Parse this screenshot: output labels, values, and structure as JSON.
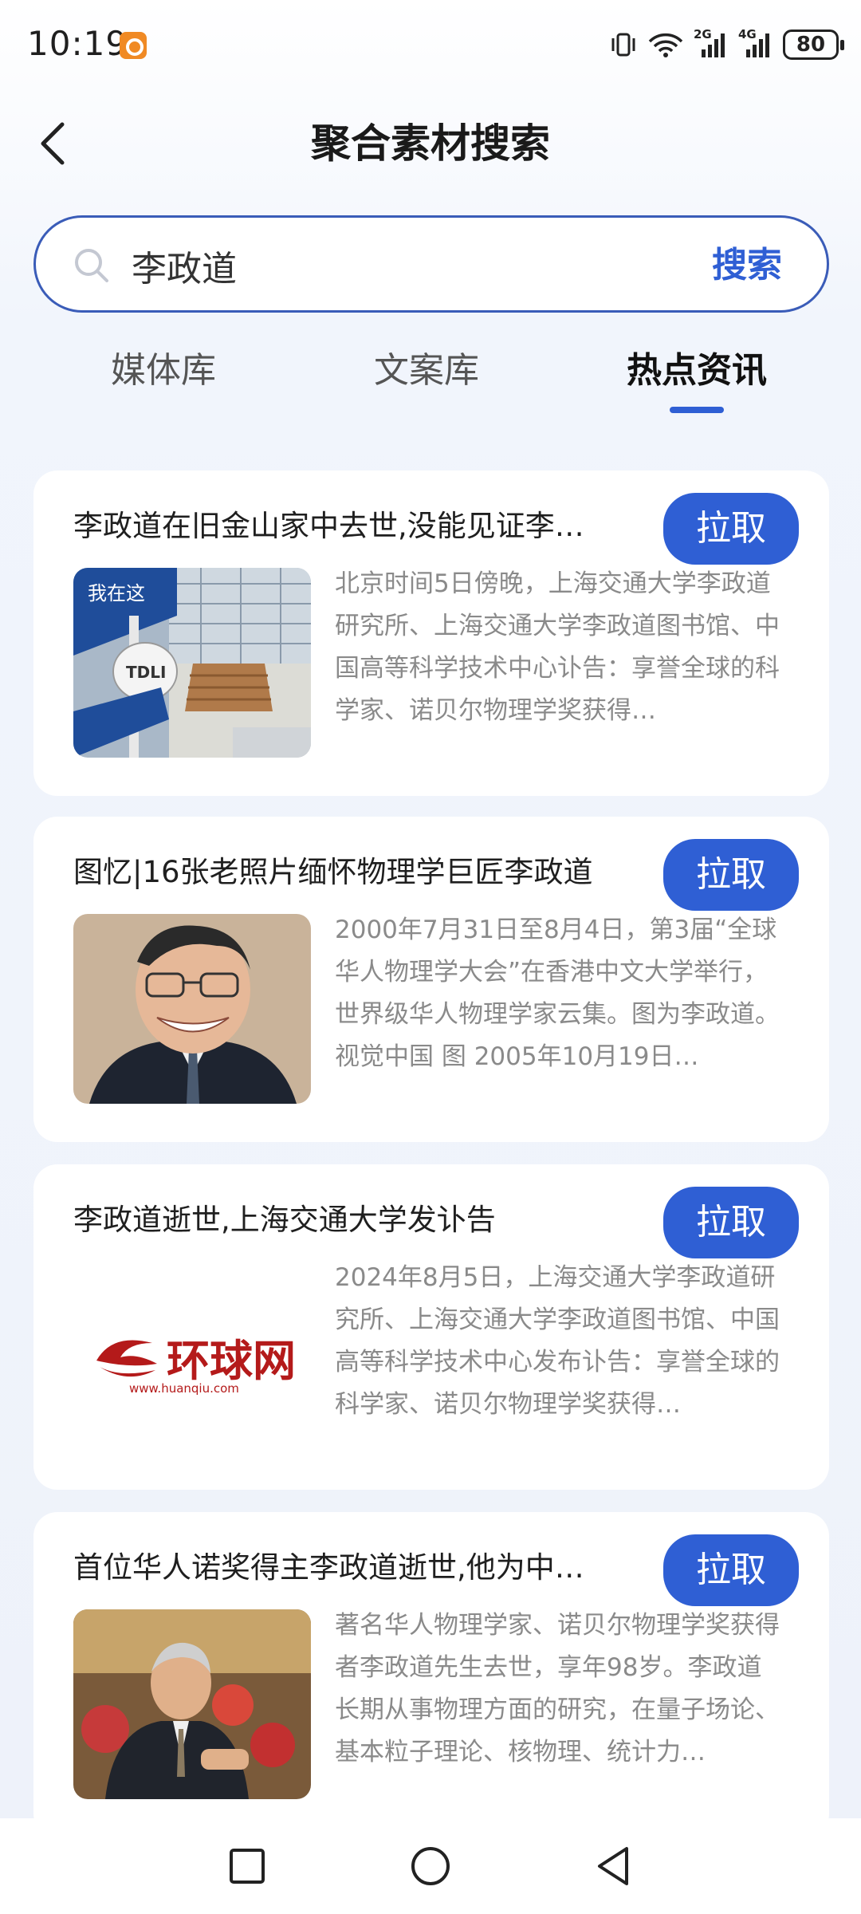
{
  "status_bar": {
    "time": "10:19",
    "battery": "80",
    "signal_1": "2G",
    "signal_2": "4G"
  },
  "header": {
    "title": "聚合素材搜索"
  },
  "search": {
    "value": "李政道",
    "button_label": "搜索"
  },
  "tabs": [
    {
      "label": "媒体库",
      "active": false
    },
    {
      "label": "文案库",
      "active": false
    },
    {
      "label": "热点资讯",
      "active": true
    }
  ],
  "pull_label": "拉取",
  "news": [
    {
      "title": "李政道在旧金山家中去世,没能见证李…",
      "desc": "北京时间5日傍晚，上海交通大学李政道研究所、上海交通大学李政道图书馆、中国高等科学技术中心讣告：享誉全球的科学家、诺贝尔物理学奖获得…",
      "thumb_texts": [
        "我在这",
        "TDLI"
      ]
    },
    {
      "title": "图忆|16张老照片缅怀物理学巨匠李政道",
      "desc": "2000年7月31日至8月4日，第3届“全球华人物理学大会”在香港中文大学举行，世界级华人物理学家云集。图为李政道。视觉中国 图 2005年10月19日…"
    },
    {
      "title": "李政道逝世,上海交通大学发讣告",
      "desc": "2024年8月5日，上海交通大学李政道研究所、上海交通大学李政道图书馆、中国高等科学技术中心发布讣告：享誉全球的科学家、诺贝尔物理学奖获得…",
      "logo_text": "环球网",
      "logo_url": "www.huanqiu.com"
    },
    {
      "title": "首位华人诺奖得主李政道逝世,他为中…",
      "desc": "著名华人物理学家、诺贝尔物理学奖获得者李政道先生去世，享年98岁。李政道长期从事物理方面的研究，在量子场论、基本粒子理论、核物理、统计力…"
    }
  ],
  "colors": {
    "accent": "#2f5fd4",
    "search_border": "#3a5cb8",
    "desc_text": "#8a8a8a"
  }
}
